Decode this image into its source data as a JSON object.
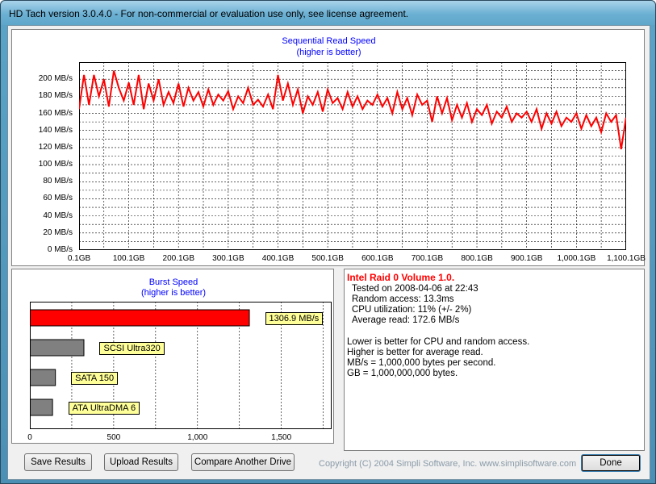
{
  "window": {
    "title": "HD Tach version 3.0.4.0  - For non-commercial or evaluation use only, see license agreement."
  },
  "seq_chart": {
    "title": "Sequential Read Speed",
    "subtitle": "(higher is better)",
    "y_ticks": [
      "200 MB/s",
      "180 MB/s",
      "160 MB/s",
      "140 MB/s",
      "120 MB/s",
      "100 MB/s",
      "80 MB/s",
      "60 MB/s",
      "40 MB/s",
      "20 MB/s",
      "0 MB/s"
    ],
    "x_ticks": [
      "0.1GB",
      "100.1GB",
      "200.1GB",
      "300.1GB",
      "400.1GB",
      "500.1GB",
      "600.1GB",
      "700.1GB",
      "800.1GB",
      "900.1GB",
      "1,000.1GB",
      "1,100.1GB"
    ],
    "line_color": "#ff0000",
    "chart_data": {
      "type": "line",
      "x_unit": "GB",
      "y_unit": "MB/s",
      "ylim": [
        0,
        220
      ],
      "xlim": [
        0.1,
        1100.1
      ],
      "grid": true,
      "x": [
        0,
        10,
        20,
        30,
        40,
        50,
        60,
        70,
        80,
        90,
        100,
        110,
        120,
        130,
        140,
        150,
        160,
        170,
        180,
        190,
        200,
        210,
        220,
        230,
        240,
        250,
        260,
        270,
        280,
        290,
        300,
        310,
        320,
        330,
        340,
        350,
        360,
        370,
        380,
        390,
        400,
        410,
        420,
        430,
        440,
        450,
        460,
        470,
        480,
        490,
        500,
        510,
        520,
        530,
        540,
        550,
        560,
        570,
        580,
        590,
        600,
        610,
        620,
        630,
        640,
        650,
        660,
        670,
        680,
        690,
        700,
        710,
        720,
        730,
        740,
        750,
        760,
        770,
        780,
        790,
        800,
        810,
        820,
        830,
        840,
        850,
        860,
        870,
        880,
        890,
        900,
        910,
        920,
        930,
        940,
        950,
        960,
        970,
        980,
        990,
        1000,
        1010,
        1020,
        1030,
        1040,
        1050,
        1060,
        1070,
        1080,
        1090,
        1100
      ],
      "y": [
        165,
        205,
        170,
        205,
        180,
        200,
        168,
        210,
        190,
        175,
        196,
        170,
        205,
        165,
        195,
        175,
        200,
        170,
        185,
        172,
        195,
        168,
        190,
        175,
        185,
        168,
        188,
        170,
        182,
        175,
        186,
        165,
        180,
        172,
        190,
        170,
        176,
        168,
        182,
        165,
        205,
        175,
        195,
        170,
        188,
        160,
        180,
        170,
        185,
        162,
        188,
        172,
        178,
        165,
        185,
        168,
        180,
        165,
        175,
        170,
        182,
        168,
        178,
        160,
        185,
        165,
        178,
        158,
        182,
        170,
        175,
        150,
        180,
        160,
        178,
        152,
        170,
        155,
        172,
        150,
        165,
        158,
        170,
        148,
        162,
        155,
        168,
        150,
        160,
        155,
        162,
        150,
        165,
        142,
        160,
        148,
        162,
        145,
        155,
        150,
        160,
        142,
        158,
        145,
        155,
        138,
        160,
        150,
        158,
        118,
        155
      ]
    }
  },
  "burst_chart": {
    "title": "Burst Speed",
    "subtitle": "(higher is better)",
    "x_ticks": [
      "0",
      "500",
      "1,000",
      "1,500"
    ],
    "chart_data": {
      "type": "bar",
      "orientation": "horizontal",
      "xlim": [
        0,
        1800
      ],
      "categories": [
        "1306.9 MB/s",
        "SCSI Ultra320",
        "SATA 150",
        "ATA UltraDMA 6"
      ],
      "values": [
        1306.9,
        320,
        150,
        133
      ],
      "colors": [
        "#ff0000",
        "#808080",
        "#808080",
        "#808080"
      ]
    }
  },
  "info": {
    "drive_name": "Intel Raid 0 Volume 1.0.",
    "tested_on": "Tested on 2008-04-06 at 22:43",
    "random_access": "Random access: 13.3ms",
    "cpu": "CPU utilization: 11% (+/- 2%)",
    "avg_read": "Average read: 172.6 MB/s",
    "note1": "Lower is better for CPU and random access.",
    "note2": "Higher is better for average read.",
    "note3": "MB/s = 1,000,000 bytes per second.",
    "note4": "GB = 1,000,000,000 bytes."
  },
  "buttons": {
    "save": "Save Results",
    "upload": "Upload Results",
    "compare": "Compare Another Drive",
    "done": "Done"
  },
  "copyright": "Copyright (C) 2004 Simpli Software, Inc. www.simplisoftware.com"
}
